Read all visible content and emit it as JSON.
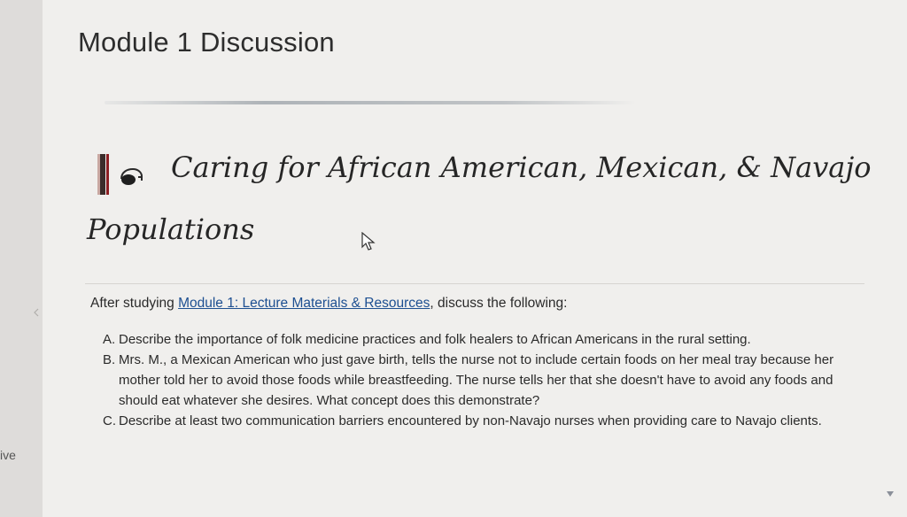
{
  "rail": {
    "label": "ive"
  },
  "page": {
    "title": "Module 1 Discussion"
  },
  "heading": {
    "line1": "Caring for African American, Mexican, & Navajo",
    "line2": "Populations"
  },
  "intro": {
    "prefix": "After studying ",
    "link": "Module 1: Lecture Materials & Resources",
    "suffix": ", discuss the following:"
  },
  "items": [
    {
      "letter": "A.",
      "text": "Describe the importance of folk medicine practices and folk healers to African Americans in the rural setting."
    },
    {
      "letter": "B.",
      "text": "Mrs. M., a Mexican American who just gave birth, tells the nurse not to include certain foods on her meal tray because her mother told her to avoid those foods while breastfeeding. The nurse tells her that she doesn't have to avoid any foods and should eat whatever she desires. What concept does this demonstrate?"
    },
    {
      "letter": "C.",
      "text": "Describe at least two communication barriers encountered by non-Navajo nurses when providing care to Navajo clients."
    }
  ],
  "colors": {
    "link": "#1d4f91",
    "accent_bar": "#8c1d22"
  },
  "icons": {
    "heading": "speech-bubble-icon",
    "cursor": "mouse-pointer-icon",
    "rail": "chevron-left-icon",
    "scroll": "chevron-down-icon"
  }
}
